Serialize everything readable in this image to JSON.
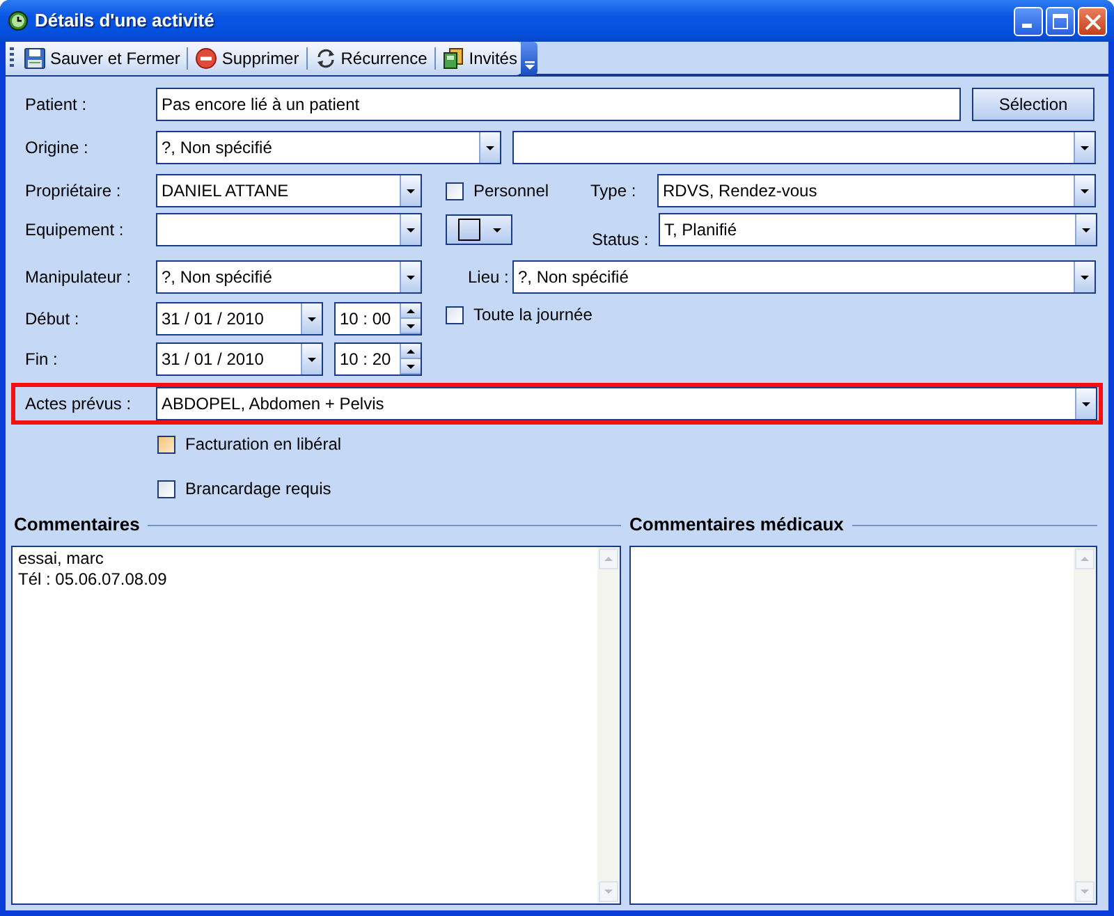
{
  "window": {
    "title": "Détails d'une activité"
  },
  "toolbar": [
    {
      "label": "Sauver et Fermer"
    },
    {
      "label": "Supprimer"
    },
    {
      "label": "Récurrence"
    },
    {
      "label": "Invités"
    }
  ],
  "patient": {
    "label": "Patient :",
    "value": "Pas encore lié à un patient",
    "button": "Sélection"
  },
  "origine": {
    "label": "Origine :",
    "value": "?, Non spécifié"
  },
  "proprietaire": {
    "label": "Propriétaire :",
    "value": "DANIEL ATTANE"
  },
  "personnel": {
    "label": "Personnel",
    "checked": false
  },
  "type": {
    "label": "Type :",
    "value": "RDVS, Rendez-vous"
  },
  "equipement": {
    "label": "Equipement :"
  },
  "status": {
    "label": "Status :",
    "value": "T, Planifié"
  },
  "manipulateur": {
    "label": "Manipulateur :",
    "value": "?, Non spécifié"
  },
  "lieu": {
    "label": "Lieu :",
    "value": "?, Non spécifié"
  },
  "debut": {
    "label": "Début :",
    "date": "31 / 01 / 2010",
    "time": "10 : 00"
  },
  "toute_la_journee": {
    "label": "Toute la journée",
    "checked": false
  },
  "fin": {
    "label": "Fin :",
    "date": "31 / 01 / 2010",
    "time": "10 : 20"
  },
  "actes_prevus": {
    "label": "Actes prévus :",
    "value": "ABDOPEL, Abdomen + Pelvis",
    "highlighted": true
  },
  "options": [
    {
      "label": "Facturation en libéral",
      "checked": false,
      "kind": "tinted"
    },
    {
      "label": "Brancardage requis",
      "checked": false,
      "kind": "plain"
    }
  ],
  "comments": [
    {
      "title": "Commentaires",
      "lines": [
        "essai, marc",
        "Tél : 05.06.07.08.09"
      ]
    },
    {
      "title": "Commentaires médicaux"
    }
  ]
}
